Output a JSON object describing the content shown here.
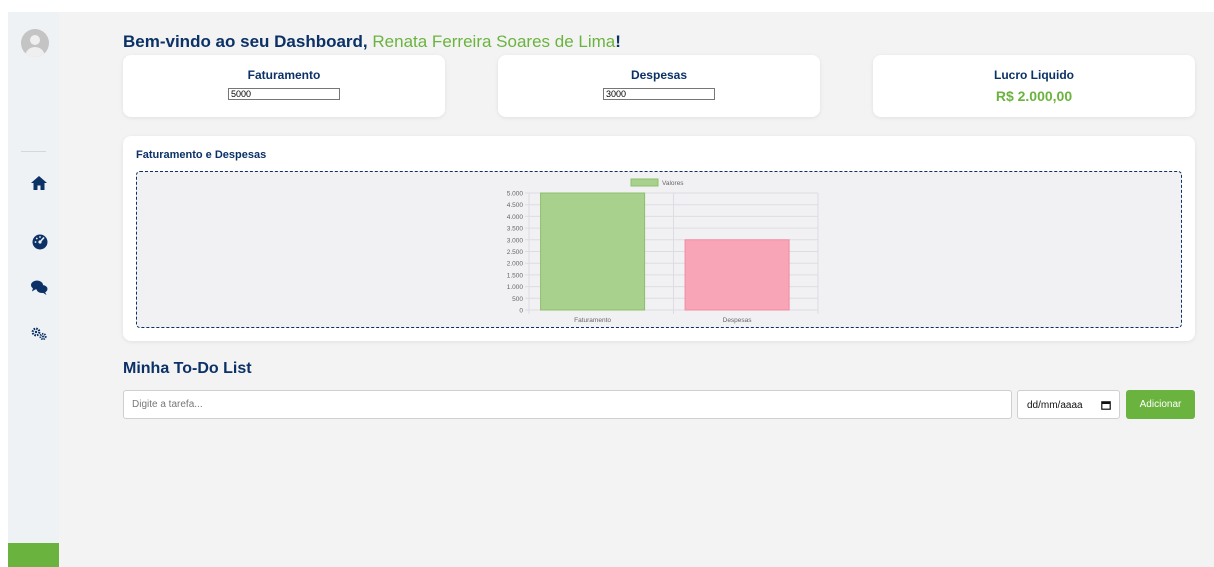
{
  "header": {
    "welcome_prefix": "Bem-vindo ao seu Dashboard, ",
    "user_name": "Renata Ferreira Soares de Lima",
    "welcome_suffix": "!"
  },
  "sidebar": {
    "items": [
      {
        "icon": "home-icon"
      },
      {
        "icon": "dashboard-gauge-icon"
      },
      {
        "icon": "chat-icon"
      },
      {
        "icon": "settings-gears-icon"
      }
    ]
  },
  "cards": {
    "faturamento": {
      "label": "Faturamento",
      "value": "5000"
    },
    "despesas": {
      "label": "Despesas",
      "value": "3000"
    },
    "lucro": {
      "label": "Lucro Liquido",
      "value": "R$ 2.000,00"
    }
  },
  "chart_section": {
    "title": "Faturamento e Despesas"
  },
  "chart_data": {
    "type": "bar",
    "categories": [
      "Faturamento",
      "Despesas"
    ],
    "series": [
      {
        "name": "Valores",
        "values": [
          5000,
          3000
        ]
      }
    ],
    "bar_colors": [
      "#a9d18e",
      "#f8a5b8"
    ],
    "bar_borders": [
      "#8dbf6c",
      "#f28aa3"
    ],
    "ylim": [
      0,
      5000
    ],
    "yticks": [
      "0",
      "500",
      "1.000",
      "1.500",
      "2.000",
      "2.500",
      "3.000",
      "3.500",
      "4.000",
      "4.500",
      "5.000"
    ],
    "legend_position": "top",
    "grid": true
  },
  "todo": {
    "title": "Minha To-Do List",
    "task_placeholder": "Digite a tarefa...",
    "date_placeholder": "dd/mm/aaaa",
    "add_label": "Adicionar"
  },
  "colors": {
    "primary": "#0b3166",
    "accent": "#6bb33f"
  }
}
